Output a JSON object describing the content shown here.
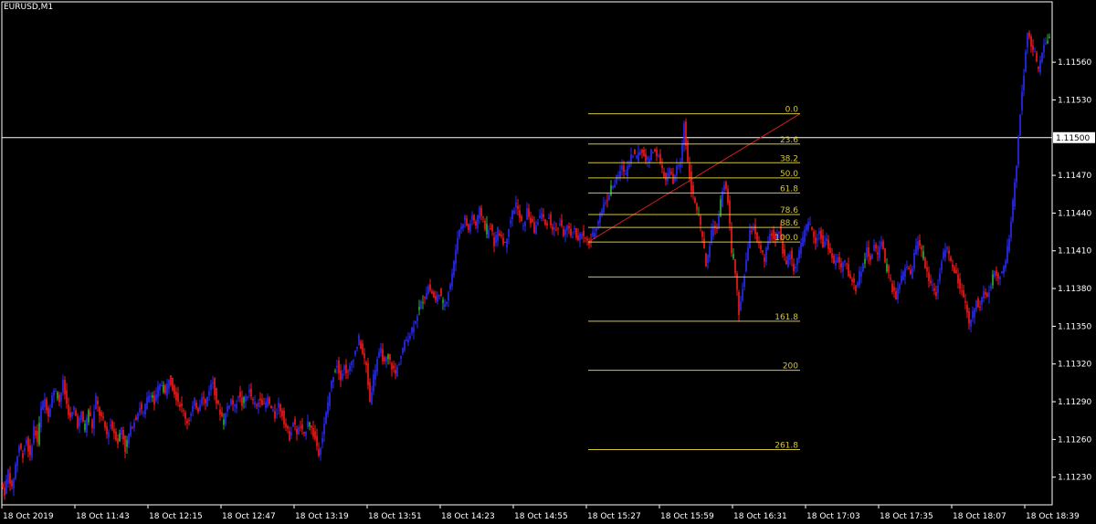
{
  "window": {
    "symbol_title": "EURUSD,M1"
  },
  "colors": {
    "background": "#000000",
    "axis": "#ffffff",
    "bull_candle": "#2a2aff",
    "bear_candle": "#ff1a1a",
    "doji_candle": "#2fb52f",
    "fibonacci": "#d4c53a",
    "trendline": "#cc1f1f",
    "crosshair": "#ffffff"
  },
  "current_price_tag": "1.11500",
  "fibonacci_levels": [
    "0.0",
    "23.6",
    "38.2",
    "50.0",
    "61.8",
    "78.6",
    "88.6",
    "100.0",
    "",
    "161.8",
    "200",
    "261.8"
  ],
  "chart_data": {
    "type": "candlestick",
    "title": "EURUSD,M1",
    "y_ticks": [
      "1.11560",
      "1.11530",
      "1.11470",
      "1.11440",
      "1.11410",
      "1.11380",
      "1.11350",
      "1.11320",
      "1.11290",
      "1.11260",
      "1.11230"
    ],
    "x_ticks": [
      "18 Oct 2019",
      "18 Oct 11:43",
      "18 Oct 12:15",
      "18 Oct 12:47",
      "18 Oct 13:19",
      "18 Oct 13:51",
      "18 Oct 14:23",
      "18 Oct 14:55",
      "18 Oct 15:27",
      "18 Oct 15:59",
      "18 Oct 16:31",
      "18 Oct 17:03",
      "18 Oct 17:35",
      "18 Oct 18:07",
      "18 Oct 18:39"
    ],
    "ylim": [
      1.11208,
      1.11608
    ],
    "horizontal_line": 1.115,
    "fibonacci": {
      "from": {
        "time": "18 Oct 15:27",
        "price": 1.11417
      },
      "to": {
        "time": "18 Oct 16:31",
        "price": 1.11519
      }
    },
    "series_points": [
      [
        0,
        1.11225
      ],
      [
        4,
        1.11218
      ],
      [
        8,
        1.11235
      ],
      [
        12,
        1.1122
      ],
      [
        16,
        1.1124
      ],
      [
        20,
        1.11255
      ],
      [
        24,
        1.11248
      ],
      [
        28,
        1.1126
      ],
      [
        32,
        1.11245
      ],
      [
        36,
        1.1127
      ],
      [
        40,
        1.11258
      ],
      [
        44,
        1.11285
      ],
      [
        48,
        1.11292
      ],
      [
        52,
        1.1128
      ],
      [
        56,
        1.11295
      ],
      [
        60,
        1.113
      ],
      [
        64,
        1.1129
      ],
      [
        68,
        1.11305
      ],
      [
        72,
        1.11288
      ],
      [
        76,
        1.11276
      ],
      [
        80,
        1.11285
      ],
      [
        84,
        1.11272
      ],
      [
        88,
        1.1128
      ],
      [
        92,
        1.11268
      ],
      [
        96,
        1.11284
      ],
      [
        100,
        1.1127
      ],
      [
        104,
        1.11293
      ],
      [
        108,
        1.1128
      ],
      [
        112,
        1.11274
      ],
      [
        116,
        1.11264
      ],
      [
        120,
        1.11272
      ],
      [
        124,
        1.11266
      ],
      [
        128,
        1.11258
      ],
      [
        132,
        1.1127
      ],
      [
        136,
        1.11252
      ],
      [
        140,
        1.11264
      ],
      [
        144,
        1.11272
      ],
      [
        148,
        1.11278
      ],
      [
        152,
        1.11286
      ],
      [
        156,
        1.1128
      ],
      [
        160,
        1.11292
      ],
      [
        164,
        1.11298
      ],
      [
        168,
        1.11288
      ],
      [
        172,
        1.113
      ],
      [
        176,
        1.11304
      ],
      [
        180,
        1.11296
      ],
      [
        184,
        1.1131
      ],
      [
        188,
        1.11302
      ],
      [
        192,
        1.11294
      ],
      [
        196,
        1.11288
      ],
      [
        200,
        1.11282
      ],
      [
        204,
        1.11274
      ],
      [
        208,
        1.1128
      ],
      [
        212,
        1.1129
      ],
      [
        216,
        1.11284
      ],
      [
        220,
        1.11296
      ],
      [
        224,
        1.11288
      ],
      [
        228,
        1.113
      ],
      [
        232,
        1.11306
      ],
      [
        236,
        1.1129
      ],
      [
        240,
        1.11282
      ],
      [
        244,
        1.11274
      ],
      [
        248,
        1.11286
      ],
      [
        252,
        1.11292
      ],
      [
        256,
        1.11285
      ],
      [
        260,
        1.11296
      ],
      [
        264,
        1.11288
      ],
      [
        268,
        1.11294
      ],
      [
        272,
        1.11298
      ],
      [
        276,
        1.1129
      ],
      [
        280,
        1.11286
      ],
      [
        284,
        1.11294
      ],
      [
        288,
        1.11286
      ],
      [
        292,
        1.11292
      ],
      [
        296,
        1.11284
      ],
      [
        300,
        1.11278
      ],
      [
        304,
        1.11288
      ],
      [
        308,
        1.1128
      ],
      [
        312,
        1.1127
      ],
      [
        316,
        1.11262
      ],
      [
        320,
        1.11274
      ],
      [
        324,
        1.11266
      ],
      [
        328,
        1.1127
      ],
      [
        332,
        1.11262
      ],
      [
        336,
        1.11276
      ],
      [
        340,
        1.11268
      ],
      [
        344,
        1.1126
      ],
      [
        348,
        1.1125
      ],
      [
        352,
        1.11262
      ],
      [
        356,
        1.1128
      ],
      [
        360,
        1.11298
      ],
      [
        364,
        1.11312
      ],
      [
        368,
        1.1132
      ],
      [
        372,
        1.1131
      ],
      [
        376,
        1.11318
      ],
      [
        380,
        1.11312
      ],
      [
        384,
        1.11322
      ],
      [
        388,
        1.1133
      ],
      [
        392,
        1.1134
      ],
      [
        396,
        1.11328
      ],
      [
        400,
        1.11318
      ],
      [
        404,
        1.1129
      ],
      [
        408,
        1.1131
      ],
      [
        412,
        1.11324
      ],
      [
        416,
        1.1133
      ],
      [
        420,
        1.1132
      ],
      [
        424,
        1.11326
      ],
      [
        428,
        1.11318
      ],
      [
        432,
        1.11312
      ],
      [
        436,
        1.11322
      ],
      [
        440,
        1.11332
      ],
      [
        444,
        1.1134
      ],
      [
        448,
        1.11344
      ],
      [
        452,
        1.11352
      ],
      [
        456,
        1.1136
      ],
      [
        460,
        1.11368
      ],
      [
        464,
        1.11374
      ],
      [
        468,
        1.11382
      ],
      [
        472,
        1.11376
      ],
      [
        476,
        1.1137
      ],
      [
        480,
        1.11378
      ],
      [
        484,
        1.11366
      ],
      [
        488,
        1.11372
      ],
      [
        492,
        1.11384
      ],
      [
        496,
        1.114
      ],
      [
        500,
        1.11422
      ],
      [
        504,
        1.1143
      ],
      [
        508,
        1.11436
      ],
      [
        512,
        1.11426
      ],
      [
        516,
        1.11438
      ],
      [
        520,
        1.1143
      ],
      [
        524,
        1.11442
      ],
      [
        528,
        1.11436
      ],
      [
        532,
        1.11422
      ],
      [
        536,
        1.1143
      ],
      [
        540,
        1.11416
      ],
      [
        544,
        1.11426
      ],
      [
        548,
        1.11422
      ],
      [
        552,
        1.11414
      ],
      [
        556,
        1.1143
      ],
      [
        560,
        1.1144
      ],
      [
        564,
        1.11448
      ],
      [
        568,
        1.11436
      ],
      [
        572,
        1.11428
      ],
      [
        576,
        1.11442
      ],
      [
        580,
        1.11434
      ],
      [
        584,
        1.11426
      ],
      [
        588,
        1.11434
      ],
      [
        592,
        1.1144
      ],
      [
        596,
        1.1143
      ],
      [
        600,
        1.11436
      ],
      [
        604,
        1.11428
      ],
      [
        608,
        1.11426
      ],
      [
        612,
        1.11432
      ],
      [
        616,
        1.11424
      ],
      [
        620,
        1.11428
      ],
      [
        624,
        1.11422
      ],
      [
        628,
        1.11426
      ],
      [
        632,
        1.1142
      ],
      [
        636,
        1.11424
      ],
      [
        640,
        1.11418
      ],
      [
        644,
        1.11416
      ],
      [
        648,
        1.11422
      ],
      [
        652,
        1.1143
      ],
      [
        656,
        1.1144
      ],
      [
        660,
        1.11446
      ],
      [
        664,
        1.11452
      ],
      [
        668,
        1.1146
      ],
      [
        672,
        1.11464
      ],
      [
        676,
        1.1147
      ],
      [
        680,
        1.11476
      ],
      [
        684,
        1.11472
      ],
      [
        688,
        1.11482
      ],
      [
        692,
        1.11488
      ],
      [
        696,
        1.11484
      ],
      [
        700,
        1.1149
      ],
      [
        704,
        1.11486
      ],
      [
        708,
        1.11482
      ],
      [
        712,
        1.11488
      ],
      [
        716,
        1.1149
      ],
      [
        720,
        1.11484
      ],
      [
        724,
        1.11474
      ],
      [
        728,
        1.11466
      ],
      [
        732,
        1.11474
      ],
      [
        736,
        1.11464
      ],
      [
        740,
        1.11476
      ],
      [
        744,
        1.1148
      ],
      [
        748,
        1.11512
      ],
      [
        752,
        1.1148
      ],
      [
        756,
        1.1146
      ],
      [
        760,
        1.11448
      ],
      [
        764,
        1.11436
      ],
      [
        768,
        1.1142
      ],
      [
        772,
        1.11398
      ],
      [
        776,
        1.11416
      ],
      [
        780,
        1.11432
      ],
      [
        784,
        1.11426
      ],
      [
        788,
        1.11448
      ],
      [
        792,
        1.11464
      ],
      [
        796,
        1.1145
      ],
      [
        800,
        1.1141
      ],
      [
        804,
        1.11392
      ],
      [
        808,
        1.1136
      ],
      [
        812,
        1.1138
      ],
      [
        816,
        1.11402
      ],
      [
        820,
        1.11424
      ],
      [
        824,
        1.1143
      ],
      [
        828,
        1.11418
      ],
      [
        832,
        1.1141
      ],
      [
        836,
        1.11402
      ],
      [
        840,
        1.11418
      ],
      [
        844,
        1.11424
      ],
      [
        848,
        1.11418
      ],
      [
        852,
        1.11428
      ],
      [
        856,
        1.1141
      ],
      [
        860,
        1.114
      ],
      [
        864,
        1.11408
      ],
      [
        868,
        1.11396
      ],
      [
        872,
        1.11404
      ],
      [
        876,
        1.11414
      ],
      [
        880,
        1.11424
      ],
      [
        884,
        1.11432
      ],
      [
        888,
        1.11428
      ],
      [
        892,
        1.11418
      ],
      [
        896,
        1.11426
      ],
      [
        900,
        1.11414
      ],
      [
        904,
        1.1142
      ],
      [
        908,
        1.11408
      ],
      [
        912,
        1.114
      ],
      [
        916,
        1.11404
      ],
      [
        920,
        1.11396
      ],
      [
        924,
        1.11402
      ],
      [
        928,
        1.11392
      ],
      [
        932,
        1.11386
      ],
      [
        936,
        1.1138
      ],
      [
        940,
        1.11392
      ],
      [
        944,
        1.114
      ],
      [
        948,
        1.1141
      ],
      [
        952,
        1.11404
      ],
      [
        956,
        1.11414
      ],
      [
        960,
        1.11406
      ],
      [
        964,
        1.1142
      ],
      [
        968,
        1.11402
      ],
      [
        972,
        1.1139
      ],
      [
        976,
        1.1138
      ],
      [
        980,
        1.11372
      ],
      [
        984,
        1.11384
      ],
      [
        988,
        1.11392
      ],
      [
        992,
        1.11398
      ],
      [
        996,
        1.1139
      ],
      [
        1000,
        1.11406
      ],
      [
        1004,
        1.1142
      ],
      [
        1008,
        1.1141
      ],
      [
        1012,
        1.11398
      ],
      [
        1016,
        1.11388
      ],
      [
        1020,
        1.11382
      ],
      [
        1024,
        1.11376
      ],
      [
        1028,
        1.11394
      ],
      [
        1032,
        1.11408
      ],
      [
        1036,
        1.11412
      ],
      [
        1040,
        1.114
      ],
      [
        1044,
        1.11394
      ],
      [
        1048,
        1.11386
      ],
      [
        1052,
        1.11376
      ],
      [
        1056,
        1.11366
      ],
      [
        1060,
        1.11352
      ],
      [
        1064,
        1.1136
      ],
      [
        1068,
        1.1137
      ],
      [
        1072,
        1.11366
      ],
      [
        1076,
        1.11378
      ],
      [
        1080,
        1.11372
      ],
      [
        1084,
        1.11384
      ],
      [
        1088,
        1.11394
      ],
      [
        1092,
        1.1139
      ],
      [
        1096,
        1.11392
      ],
      [
        1100,
        1.11402
      ],
      [
        1104,
        1.1142
      ],
      [
        1108,
        1.11448
      ],
      [
        1112,
        1.1148
      ],
      [
        1116,
        1.1152
      ],
      [
        1120,
        1.11552
      ],
      [
        1124,
        1.11586
      ],
      [
        1128,
        1.11574
      ],
      [
        1132,
        1.11566
      ],
      [
        1136,
        1.11552
      ],
      [
        1140,
        1.1157
      ],
      [
        1144,
        1.11576
      ],
      [
        1148,
        1.1158
      ]
    ]
  }
}
